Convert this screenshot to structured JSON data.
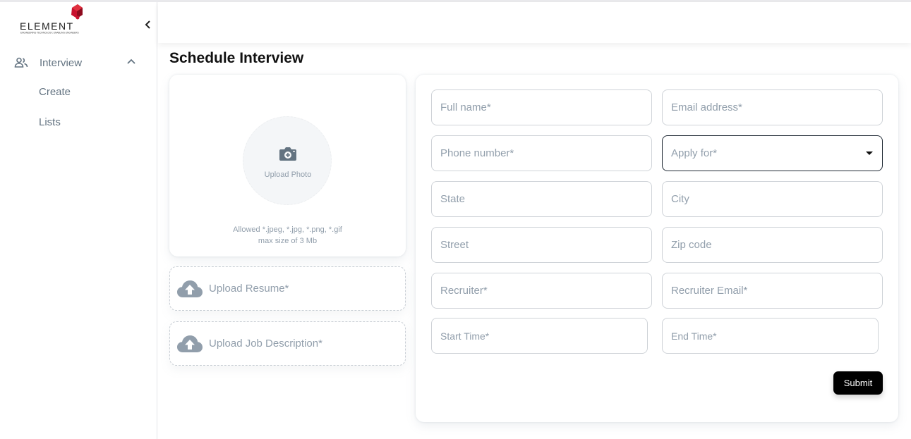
{
  "app": {
    "logo_text": "ELEMENT",
    "logo_tagline": "ENGINEERING TECHNOLOGY, ENABLING ENGINEERS"
  },
  "sidebar": {
    "group_label": "Interview",
    "items": [
      {
        "label": "Create"
      },
      {
        "label": "Lists"
      }
    ]
  },
  "page": {
    "title": "Schedule Interview"
  },
  "photo_upload": {
    "label": "Upload Photo",
    "allowed_line1": "Allowed *.jpeg, *.jpg, *.png, *.gif",
    "allowed_line2": "max size of 3 Mb"
  },
  "uploads": {
    "resume_label": "Upload Resume*",
    "job_description_label": "Upload Job Description*"
  },
  "form": {
    "full_name": {
      "placeholder": "Full name*",
      "value": ""
    },
    "email": {
      "placeholder": "Email address*",
      "value": ""
    },
    "phone": {
      "placeholder": "Phone number*",
      "value": ""
    },
    "apply_for": {
      "label": "Apply for*",
      "value": ""
    },
    "state": {
      "placeholder": "State",
      "value": ""
    },
    "city": {
      "placeholder": "City",
      "value": ""
    },
    "street": {
      "placeholder": "Street",
      "value": ""
    },
    "zip": {
      "placeholder": "Zip code",
      "value": ""
    },
    "recruiter": {
      "placeholder": "Recruiter*",
      "value": ""
    },
    "recruiter_email": {
      "placeholder": "Recruiter Email*",
      "value": ""
    },
    "start_time": {
      "placeholder": "Start Time*",
      "value": ""
    },
    "end_time": {
      "placeholder": "End Time*",
      "value": ""
    },
    "submit_label": "Submit"
  },
  "colors": {
    "accent": "#000000",
    "logo_red": "#c8102e",
    "muted_text": "#919eab",
    "nav_text": "#637381"
  }
}
